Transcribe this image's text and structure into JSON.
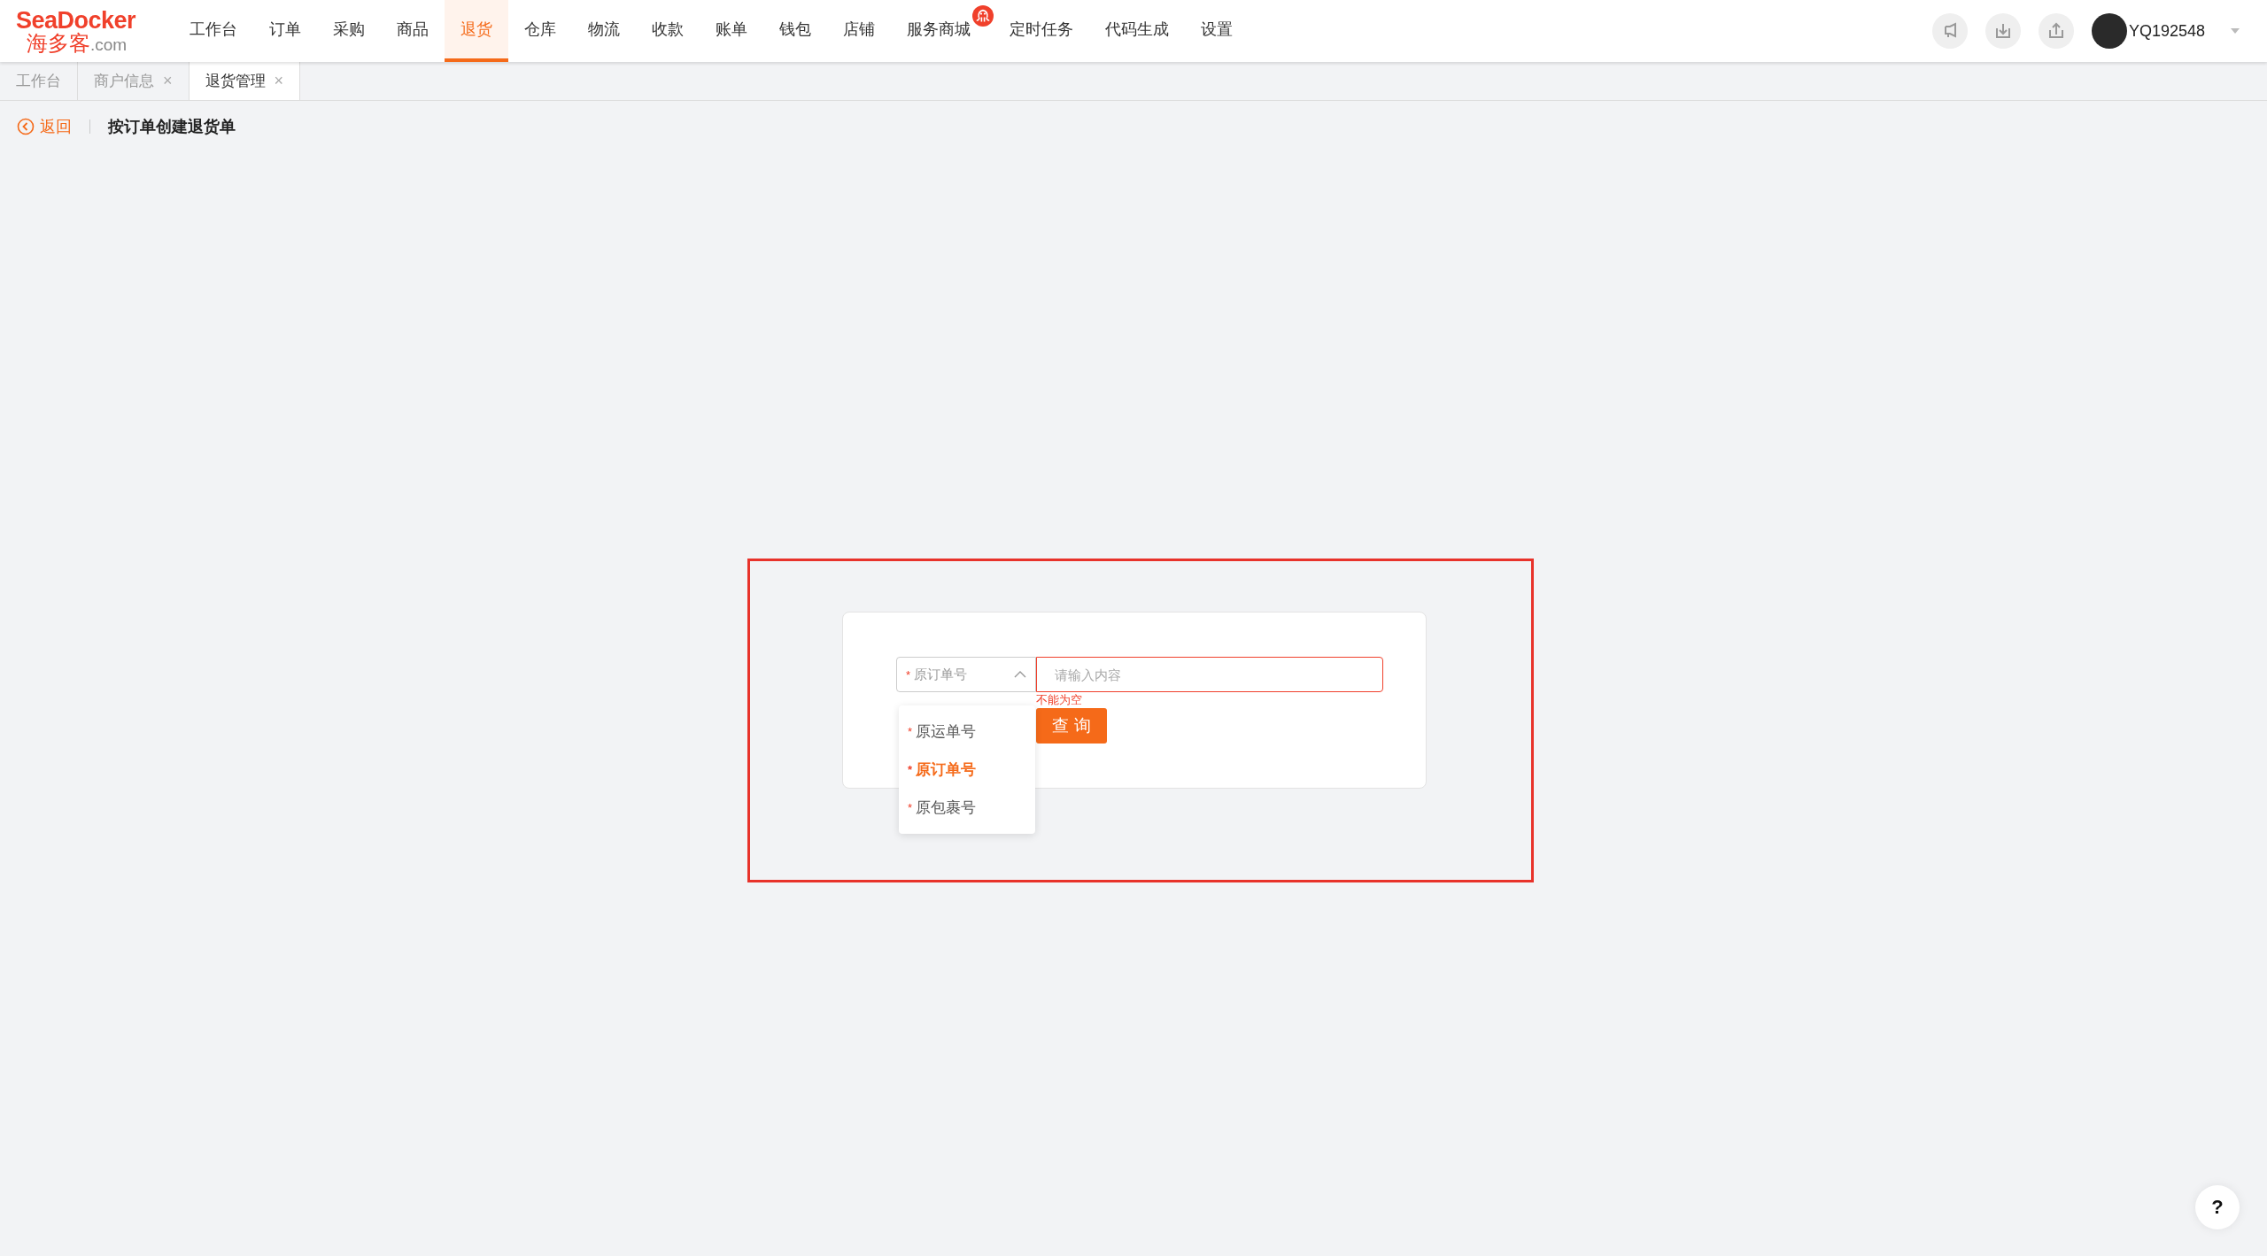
{
  "header": {
    "logo": {
      "brand": "SeaDocker",
      "cn_name": "海多客",
      "domain": ".com"
    },
    "nav": [
      {
        "label": "工作台",
        "selected": false,
        "badge": false
      },
      {
        "label": "订单",
        "selected": false,
        "badge": false
      },
      {
        "label": "采购",
        "selected": false,
        "badge": false
      },
      {
        "label": "商品",
        "selected": false,
        "badge": false
      },
      {
        "label": "退货",
        "selected": true,
        "badge": false
      },
      {
        "label": "仓库",
        "selected": false,
        "badge": false
      },
      {
        "label": "物流",
        "selected": false,
        "badge": false
      },
      {
        "label": "收款",
        "selected": false,
        "badge": false
      },
      {
        "label": "账单",
        "selected": false,
        "badge": false
      },
      {
        "label": "钱包",
        "selected": false,
        "badge": false
      },
      {
        "label": "店铺",
        "selected": false,
        "badge": false
      },
      {
        "label": "服务商城",
        "selected": false,
        "badge": true
      },
      {
        "label": "定时任务",
        "selected": false,
        "badge": false
      },
      {
        "label": "代码生成",
        "selected": false,
        "badge": false
      },
      {
        "label": "设置",
        "selected": false,
        "badge": false
      }
    ],
    "user": {
      "name": "YQ192548"
    }
  },
  "tabs": [
    {
      "label": "工作台",
      "selected": false
    },
    {
      "label": "商户信息",
      "selected": false,
      "close": "×"
    },
    {
      "label": "退货管理",
      "selected": true,
      "close": "×"
    }
  ],
  "breadcrumb": {
    "back": "返回",
    "title": "按订单创建退货单"
  },
  "annotation_frame": {
    "shown": true
  },
  "form": {
    "select": {
      "required_mark": "*",
      "value": "原订单号",
      "expanded": true
    },
    "input": {
      "placeholder": "请输入内容",
      "error": "不能为空"
    },
    "search_button": "查 询",
    "options": [
      {
        "mark": "*",
        "label": "原运单号",
        "selected": false
      },
      {
        "mark": "*",
        "label": "原订单号",
        "selected": true
      },
      {
        "mark": "*",
        "label": "原包裹号",
        "selected": false
      }
    ]
  },
  "help": "?"
}
